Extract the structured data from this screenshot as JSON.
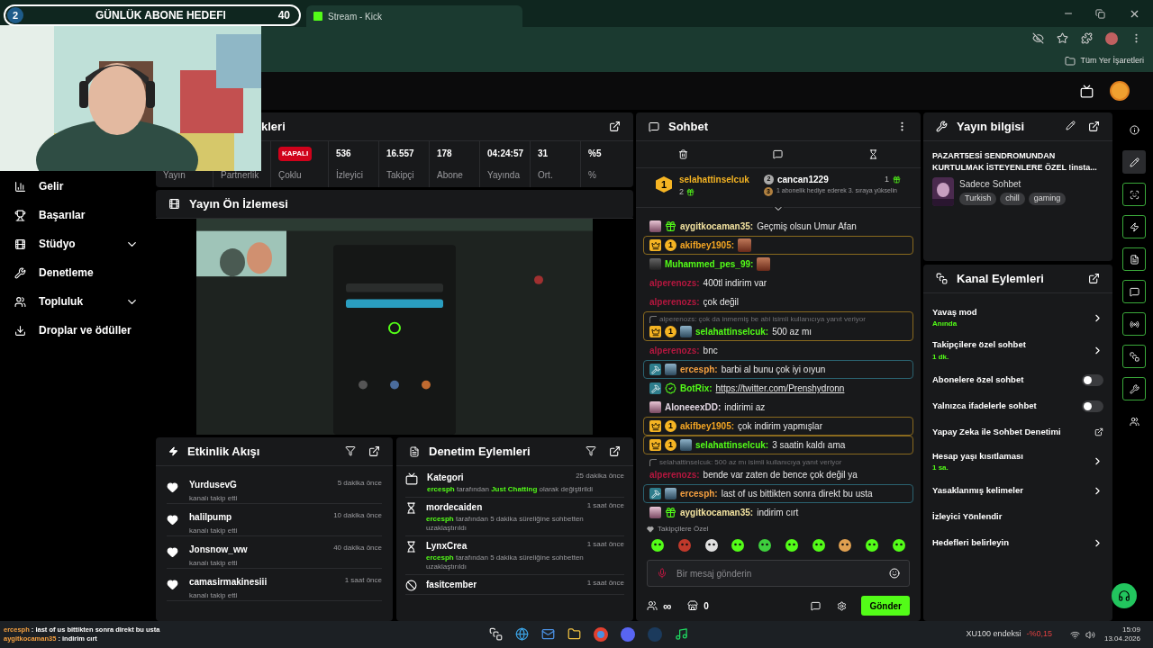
{
  "overlay": {
    "rank": "2",
    "goal_title": "GÜNLÜK ABONE HEDEFI",
    "goal_value": "40"
  },
  "browser": {
    "tab_title": "Stream - Kick",
    "bookmarks_label": "Tüm Yer İşaretleri"
  },
  "sidebar": {
    "items": [
      {
        "label": "Gelir",
        "expandable": false
      },
      {
        "label": "Başarılar",
        "expandable": false
      },
      {
        "label": "Stüdyo",
        "expandable": true
      },
      {
        "label": "Denetleme",
        "expandable": false
      },
      {
        "label": "Topluluk",
        "expandable": true
      },
      {
        "label": "Droplar ve ödüller",
        "expandable": false
      }
    ]
  },
  "stats": {
    "title": "kleri",
    "items": [
      {
        "label": "Yayın"
      },
      {
        "label": "Partnerlik"
      },
      {
        "badge": "KAPALI",
        "label": "Çoklu"
      },
      {
        "value": "536",
        "label": "İzleyici"
      },
      {
        "value": "16.557",
        "label": "Takipçi"
      },
      {
        "value": "178",
        "label": "Abone"
      },
      {
        "value": "04:24:57",
        "label": "Yayında"
      },
      {
        "value": "31",
        "label": "Ort."
      },
      {
        "value": "%5",
        "label": "%"
      }
    ]
  },
  "preview": {
    "title": "Yayın Ön İzlemesi"
  },
  "activity": {
    "title": "Etkinlik Akışı",
    "items": [
      {
        "user": "YurdusevG",
        "action": "kanalı takip etti",
        "time": "5 dakika önce"
      },
      {
        "user": "halilpump",
        "action": "kanalı takip etti",
        "time": "10 dakika önce"
      },
      {
        "user": "Jonsnow_ww",
        "action": "kanalı takip etti",
        "time": "40 dakika önce"
      },
      {
        "user": "camasirmakinesiii",
        "action": "kanalı takip etti",
        "time": "1 saat önce"
      }
    ]
  },
  "moderation": {
    "title": "Denetim Eylemleri",
    "items": [
      {
        "kind": "category",
        "title": "Kategori",
        "detail": "**ercesph** tarafından **Just Chatting** olarak değiştirildi",
        "time": "25 dakika önce"
      },
      {
        "kind": "timeout",
        "title": "mordecaiden",
        "detail": "**ercesph** tarafından 5 dakika süreliğine sohbetten uzaklaştırıldı",
        "time": "1 saat önce"
      },
      {
        "kind": "timeout",
        "title": "LynxCrea",
        "detail": "**ercesph** tarafından 5 dakika süreliğine sohbetten uzaklaştırıldı",
        "time": "1 saat önce"
      },
      {
        "kind": "ban",
        "title": "fasitcember",
        "time": "1 saat önce"
      }
    ]
  },
  "chat": {
    "title": "Sohbet",
    "leaderboard": {
      "first_rank": "1",
      "first_user": "selahattinselcuk",
      "first_count": "2",
      "second_rank": "2",
      "second_user": "cancan1229",
      "second_count": "1",
      "third_rank": "3",
      "third_hint": "1 abonelik hediye ederek 3. sıraya yükselin"
    },
    "messages": [
      {
        "kind": "plain",
        "badges": [
          {
            "kind": "og"
          },
          {
            "kind": "sub"
          }
        ],
        "user": "aygitkocaman35:",
        "color": "#f3e3a0",
        "text": "Geçmiş olsun Umur Afan"
      },
      {
        "kind": "gold",
        "badges": [
          {
            "kind": "crown"
          },
          {
            "kind": "gifter",
            "text": "1"
          }
        ],
        "user": "akifbey1905:",
        "color": "#f5a623",
        "emote": true
      },
      {
        "kind": "plain",
        "badges": [
          {
            "kind": "og_dark"
          }
        ],
        "user": "Muhammed_pes_99:",
        "color": "#53fc18",
        "emote": true
      },
      {
        "kind": "plain",
        "user": "alperenozs:",
        "color": "#b5173f",
        "text": "400tl indirim var"
      },
      {
        "kind": "plain",
        "user": "alperenozs:",
        "color": "#b5173f",
        "text": "çok değil"
      },
      {
        "kind": "gold",
        "badges": [
          {
            "kind": "crown"
          },
          {
            "kind": "gifter",
            "text": "1"
          },
          {
            "kind": "og_blue"
          }
        ],
        "user": "selahattinselcuk:",
        "color": "#53fc18",
        "reply": "alperenozs: çok da inmemiş be abi isimli kullanıcıya yanıt veriyor",
        "text": "500 az mı"
      },
      {
        "kind": "plain",
        "user": "alperenozs:",
        "color": "#b5173f",
        "text": "bnc"
      },
      {
        "kind": "blue",
        "badges": [
          {
            "kind": "mod"
          },
          {
            "kind": "og_blue"
          }
        ],
        "user": "ercesph:",
        "color": "#f5a040",
        "text": "barbi al bunu çok iyi oıyun"
      },
      {
        "kind": "plain",
        "badges": [
          {
            "kind": "mod"
          },
          {
            "kind": "verified"
          }
        ],
        "user": "BotRix:",
        "color": "#53fc18",
        "link": "https://twitter.com/Prenshydronn"
      },
      {
        "kind": "plain",
        "badges": [
          {
            "kind": "og"
          }
        ],
        "user": "AloneeexDD:",
        "color": "#e2d6e2",
        "text": "indirimi az"
      },
      {
        "kind": "gold",
        "badges": [
          {
            "kind": "crown"
          },
          {
            "kind": "gifter",
            "text": "1"
          }
        ],
        "user": "akifbey1905:",
        "color": "#f5a623",
        "text": "çok indirim yapmışlar"
      },
      {
        "kind": "gold",
        "badges": [
          {
            "kind": "crown"
          },
          {
            "kind": "gifter",
            "text": "1"
          },
          {
            "kind": "og_blue"
          }
        ],
        "user": "selahattinselcuk:",
        "color": "#53fc18",
        "text": "3 saatin kaldı ama"
      },
      {
        "kind": "plain",
        "user": "alperenozs:",
        "color": "#b5173f",
        "reply": "selahattinselcuk: 500 az mı isimli kullanıcıya yanıt veriyor",
        "text": "bende var zaten de bence çok değil ya"
      },
      {
        "kind": "blue",
        "badges": [
          {
            "kind": "mod"
          },
          {
            "kind": "og_blue"
          }
        ],
        "user": "ercesph:",
        "color": "#f5a040",
        "text": "last of us bittikten sonra direkt bu usta"
      },
      {
        "kind": "plain",
        "badges": [
          {
            "kind": "og"
          },
          {
            "kind": "sub"
          }
        ],
        "user": "aygitkocaman35:",
        "color": "#f3e3a0",
        "text": "indirim cırt"
      }
    ],
    "emote_label": "Takipçilere Özel",
    "placeholder": "Bir mesaj gönderin",
    "points": "∞",
    "store_count": "0",
    "send": "Gönder"
  },
  "stream_info": {
    "title": "Yayın bilgisi",
    "stream_title": "PAZART5ESİ SENDROMUNDAN KURTULMAK İSTEYENLERE ÖZEL !insta...",
    "category": "Sadece Sohbet",
    "tags": [
      "Turkish",
      "chill",
      "gaming"
    ]
  },
  "channel_actions": {
    "title": "Kanal Eylemleri",
    "items": [
      {
        "kind": "chevron",
        "label": "Yavaş mod",
        "value": "Anında"
      },
      {
        "kind": "chevron",
        "label": "Takipçilere özel sohbet",
        "value": "1 dk."
      },
      {
        "kind": "toggle",
        "label": "Abonelere özel sohbet",
        "on": false
      },
      {
        "kind": "toggle",
        "label": "Yalnızca ifadelerle sohbet",
        "on": false
      },
      {
        "kind": "external",
        "label": "Yapay Zeka ile Sohbet Denetimi"
      },
      {
        "kind": "chevron",
        "label": "Hesap yaşı kısıtlaması",
        "value": "1 sa."
      },
      {
        "kind": "chevron",
        "label": "Yasaklanmış kelimeler"
      },
      {
        "kind": "plain",
        "label": "İzleyici Yönlendir"
      },
      {
        "kind": "chevron",
        "label": "Hedefleri belirleyin"
      }
    ]
  },
  "rail": [
    {
      "active": false,
      "selected": false
    },
    {
      "active": false,
      "selected": true
    },
    {
      "active": true,
      "selected": false
    },
    {
      "active": true,
      "selected": false
    },
    {
      "active": true,
      "selected": false
    },
    {
      "active": true,
      "selected": false
    },
    {
      "active": true,
      "selected": false
    },
    {
      "active": true,
      "selected": false
    },
    {
      "active": true,
      "selected": false
    },
    {
      "active": false,
      "selected": false
    }
  ],
  "taskbar": {
    "ticker": [
      "**ercesph** : last of us bittikten sonra direkt bu usta",
      "**aygitkocaman35** : indirim cırt"
    ],
    "index_name": "XU100 endeksi",
    "index_change": "-%0,15",
    "time": "15:09",
    "date": "13.04.2026"
  }
}
